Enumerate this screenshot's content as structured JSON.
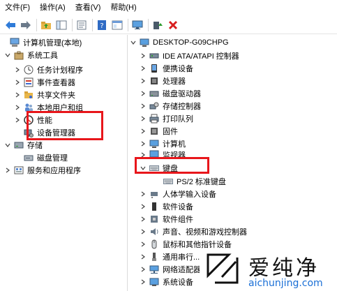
{
  "menu": [
    "文件(F)",
    "操作(A)",
    "查看(V)",
    "帮助(H)"
  ],
  "toolbar": {
    "icons": [
      "back-arrow-icon",
      "forward-arrow-icon",
      "up-folder-icon",
      "show-hide-tree-icon",
      "properties-icon",
      "help-icon",
      "console-icon",
      "monitor-icon",
      "update-driver-icon",
      "uninstall-x-icon"
    ]
  },
  "left_tree": [
    {
      "label": "计算机管理(本地)",
      "icon": "computer-management-icon",
      "chev": ""
    },
    {
      "label": "系统工具",
      "icon": "tools-icon",
      "chev": "v"
    },
    {
      "label": "任务计划程序",
      "icon": "clock-icon",
      "chev": ">"
    },
    {
      "label": "事件查看器",
      "icon": "event-viewer-icon",
      "chev": ">"
    },
    {
      "label": "共享文件夹",
      "icon": "shared-folder-icon",
      "chev": ">"
    },
    {
      "label": "本地用户和组",
      "icon": "users-icon",
      "chev": ">"
    },
    {
      "label": "性能",
      "icon": "performance-icon",
      "chev": ">"
    },
    {
      "label": "设备管理器",
      "icon": "device-manager-icon",
      "chev": ""
    },
    {
      "label": "存储",
      "icon": "storage-icon",
      "chev": "v"
    },
    {
      "label": "磁盘管理",
      "icon": "disk-management-icon",
      "chev": ""
    },
    {
      "label": "服务和应用程序",
      "icon": "services-icon",
      "chev": ">"
    }
  ],
  "right_tree": [
    {
      "label": "DESKTOP-G09CHPG",
      "icon": "computer-icon",
      "chev": "v"
    },
    {
      "label": "IDE ATA/ATAPI 控制器",
      "icon": "ide-controller-icon",
      "chev": ">"
    },
    {
      "label": "便携设备",
      "icon": "portable-device-icon",
      "chev": ">"
    },
    {
      "label": "处理器",
      "icon": "processor-icon",
      "chev": ">"
    },
    {
      "label": "磁盘驱动器",
      "icon": "disk-drive-icon",
      "chev": ">"
    },
    {
      "label": "存储控制器",
      "icon": "storage-controller-icon",
      "chev": ">"
    },
    {
      "label": "打印队列",
      "icon": "printer-icon",
      "chev": ">"
    },
    {
      "label": "固件",
      "icon": "firmware-icon",
      "chev": ">"
    },
    {
      "label": "计算机",
      "icon": "computer-icon",
      "chev": ">"
    },
    {
      "label": "监视器",
      "icon": "monitor-icon",
      "chev": ">"
    },
    {
      "label": "键盘",
      "icon": "keyboard-icon",
      "chev": "v"
    },
    {
      "label": "PS/2 标准键盘",
      "icon": "keyboard-icon",
      "chev": ""
    },
    {
      "label": "人体学输入设备",
      "icon": "hid-icon",
      "chev": ">"
    },
    {
      "label": "软件设备",
      "icon": "software-device-icon",
      "chev": ">"
    },
    {
      "label": "软件组件",
      "icon": "software-component-icon",
      "chev": ">"
    },
    {
      "label": "声音、视频和游戏控制器",
      "icon": "audio-icon",
      "chev": ">"
    },
    {
      "label": "鼠标和其他指针设备",
      "icon": "mouse-icon",
      "chev": ">"
    },
    {
      "label": "通用串行...",
      "icon": "usb-icon",
      "chev": ">"
    },
    {
      "label": "网络适配器",
      "icon": "network-adapter-icon",
      "chev": ">"
    },
    {
      "label": "系统设备",
      "icon": "system-device-icon",
      "chev": ">"
    }
  ],
  "watermark": {
    "title": "爱纯净",
    "url": "aichunjing.com"
  },
  "colors": {
    "highlight": "#e8161b",
    "watermark_url": "#1a6fd6"
  }
}
